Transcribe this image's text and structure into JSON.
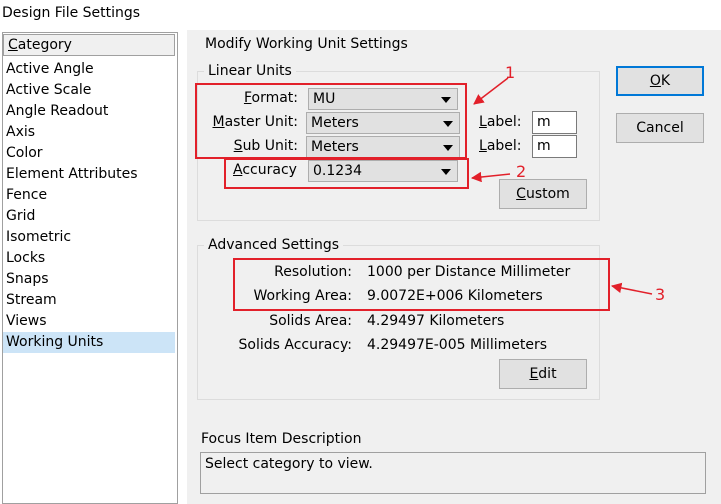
{
  "window": {
    "title": "Design File Settings"
  },
  "sidebar": {
    "header": "Category",
    "items": [
      "Active Angle",
      "Active Scale",
      "Angle Readout",
      "Axis",
      "Color",
      "Element Attributes",
      "Fence",
      "Grid",
      "Isometric",
      "Locks",
      "Snaps",
      "Stream",
      "Views",
      "Working Units"
    ],
    "selected": "Working Units"
  },
  "main": {
    "heading": "Modify Working Unit Settings",
    "linear_units": {
      "group_label": "Linear Units",
      "format_label": "Format:",
      "format_value": "MU",
      "master_unit_label": "Master Unit:",
      "master_unit_value": "Meters",
      "sub_unit_label": "Sub Unit:",
      "sub_unit_value": "Meters",
      "master_label_label": "Label:",
      "master_label_value": "m",
      "sub_label_label": "Label:",
      "sub_label_value": "m",
      "accuracy_label": "Accuracy",
      "accuracy_value": "0.1234",
      "custom_button": "Custom"
    },
    "advanced": {
      "group_label": "Advanced Settings",
      "resolution_label": "Resolution:",
      "resolution_value": "1000 per Distance Millimeter",
      "working_area_label": "Working Area:",
      "working_area_value": "9.0072E+006 Kilometers",
      "solids_area_label": "Solids Area:",
      "solids_area_value": "4.29497 Kilometers",
      "solids_accuracy_label": "Solids Accuracy:",
      "solids_accuracy_value": "4.29497E-005 Millimeters",
      "edit_button": "Edit"
    },
    "focus": {
      "label": "Focus Item Description",
      "text": "Select category to view."
    }
  },
  "buttons": {
    "ok": "OK",
    "cancel": "Cancel"
  },
  "annotations": {
    "n1": "1",
    "n2": "2",
    "n3": "3"
  },
  "colors": {
    "annotation": "#e2202a",
    "selection": "#cce4f7",
    "default_button_border": "#0078d7"
  }
}
